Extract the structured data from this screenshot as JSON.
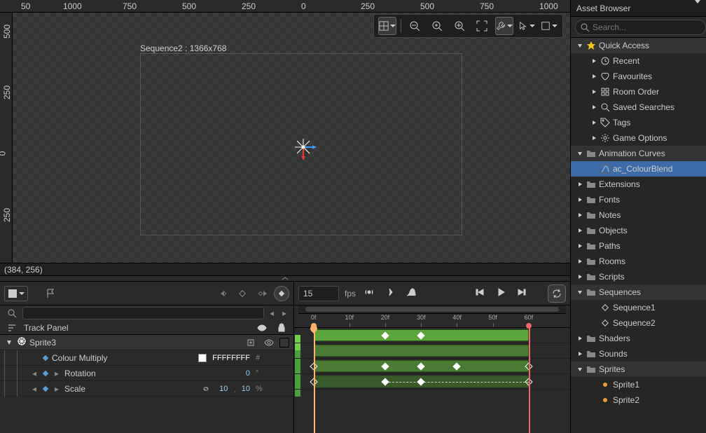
{
  "canvas": {
    "sequence_label": "Sequence2 : 1366x768",
    "ruler_x": [
      "50",
      "1000",
      "750",
      "500",
      "250",
      "0",
      "250",
      "500",
      "750",
      "1000"
    ],
    "ruler_x_pos": [
      30,
      90,
      175,
      260,
      345,
      430,
      515,
      600,
      685,
      770
    ],
    "ruler_y": [
      "500",
      "250",
      "0",
      "250"
    ],
    "ruler_y_pos": [
      38,
      125,
      212,
      300
    ],
    "coordinates": "(384, 256)"
  },
  "transport": {
    "fps_value": "15",
    "fps_label": "fps"
  },
  "timeline": {
    "labels": [
      "0f",
      "10f",
      "20f",
      "30f",
      "40f",
      "50f",
      "60f"
    ],
    "positions_pct": [
      7,
      20,
      33,
      46,
      59,
      72,
      85
    ],
    "region_start_pct": 7,
    "region_end_pct": 85
  },
  "trackpanel": {
    "title": "Track Panel",
    "asset": "Sprite3",
    "tracks": [
      {
        "name": "Colour Multiply",
        "hex": "FFFFFFFF",
        "unit": "#",
        "type": "color"
      },
      {
        "name": "Rotation",
        "val": "0",
        "unit": "°",
        "type": "number"
      },
      {
        "name": "Scale",
        "val1": "10",
        "val2": "10",
        "unit": "%",
        "type": "pair"
      }
    ]
  },
  "asset_browser": {
    "title": "Asset Browser",
    "search_placeholder": "Search...",
    "quick_access": {
      "label": "Quick Access",
      "items": [
        "Recent",
        "Favourites",
        "Room Order",
        "Saved Searches",
        "Tags",
        "Game Options"
      ]
    },
    "nodes": [
      {
        "label": "Animation Curves",
        "open": true,
        "children": [
          {
            "label": "ac_ColourBlend",
            "icon": "curve",
            "sel": true
          }
        ]
      },
      {
        "label": "Extensions"
      },
      {
        "label": "Fonts"
      },
      {
        "label": "Notes"
      },
      {
        "label": "Objects"
      },
      {
        "label": "Paths"
      },
      {
        "label": "Rooms"
      },
      {
        "label": "Scripts"
      },
      {
        "label": "Sequences",
        "open": true,
        "children": [
          {
            "label": "Sequence1",
            "icon": "seq"
          },
          {
            "label": "Sequence2",
            "icon": "seq"
          }
        ]
      },
      {
        "label": "Shaders"
      },
      {
        "label": "Sounds"
      },
      {
        "label": "Sprites",
        "open": true,
        "children": [
          {
            "label": "Sprite1",
            "icon": "spr"
          },
          {
            "label": "Sprite2",
            "icon": "spr"
          }
        ]
      }
    ]
  }
}
